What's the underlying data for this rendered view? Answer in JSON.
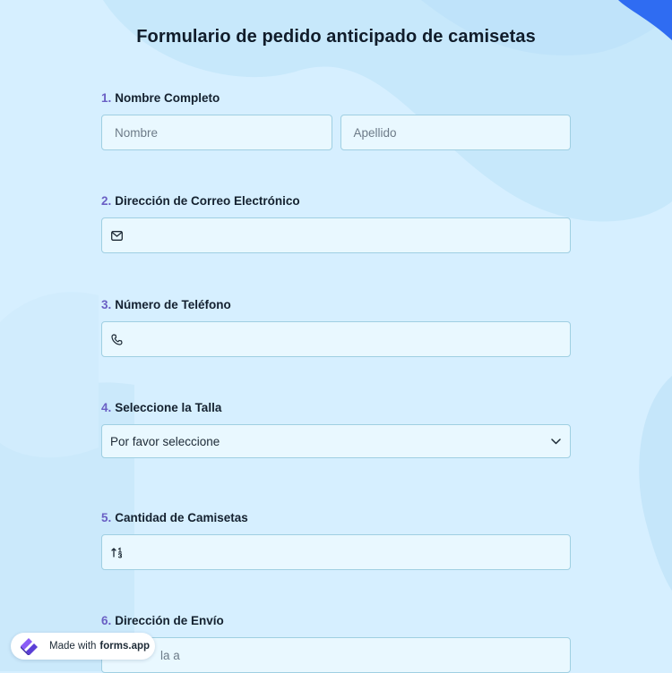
{
  "form": {
    "title": "Formulario de pedido anticipado de camisetas"
  },
  "questions": [
    {
      "number": "1.",
      "label": "Nombre Completo",
      "first_placeholder": "Nombre",
      "last_placeholder": "Apellido"
    },
    {
      "number": "2.",
      "label": "Dirección de Correo Electrónico",
      "icon": "envelope-icon"
    },
    {
      "number": "3.",
      "label": "Número de Teléfono",
      "icon": "phone-icon"
    },
    {
      "number": "4.",
      "label": "Seleccione la Talla",
      "selected": "Por favor seleccione",
      "icon": "chevron-down-icon"
    },
    {
      "number": "5.",
      "label": "Cantidad de Camisetas",
      "icon": "sort-number-icon"
    },
    {
      "number": "6.",
      "label": "Dirección de Envío",
      "partial_text": "la a"
    }
  ],
  "badge": {
    "prefix": "Made with",
    "brand": "forms.app"
  },
  "colors": {
    "background": "#d6efff",
    "field_bg": "#e9f8ff",
    "field_border": "#9fcfe2",
    "number_accent": "#6a5fc4",
    "corner_accent": "#2f6cf2"
  }
}
